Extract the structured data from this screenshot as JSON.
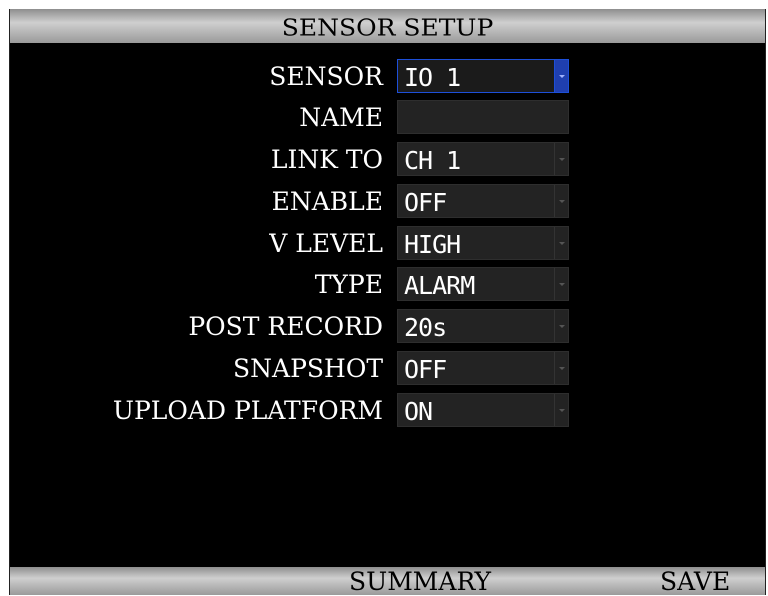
{
  "header": {
    "title": "SENSOR SETUP"
  },
  "form": {
    "rows": [
      {
        "label": "SENSOR",
        "value": "IO 1",
        "has_dropdown": true,
        "selected": true
      },
      {
        "label": "NAME",
        "value": "",
        "has_dropdown": false
      },
      {
        "label": "LINK TO",
        "value": "CH 1",
        "has_dropdown": true
      },
      {
        "label": "ENABLE",
        "value": "OFF",
        "has_dropdown": true
      },
      {
        "label": "V LEVEL",
        "value": "HIGH",
        "has_dropdown": true
      },
      {
        "label": "TYPE",
        "value": "ALARM",
        "has_dropdown": true
      },
      {
        "label": "POST RECORD",
        "value": "20s",
        "has_dropdown": true
      },
      {
        "label": "SNAPSHOT",
        "value": "OFF",
        "has_dropdown": true
      },
      {
        "label": "UPLOAD PLATFORM",
        "value": "ON",
        "has_dropdown": true
      }
    ]
  },
  "footer": {
    "summary_label": "SUMMARY",
    "save_label": "SAVE"
  },
  "colors": {
    "background": "#000000",
    "field": "#232323",
    "focus": "#1d4fd8",
    "bar": "#cfcfcf"
  },
  "icons": {
    "dropdown": "chevron-down-icon"
  }
}
